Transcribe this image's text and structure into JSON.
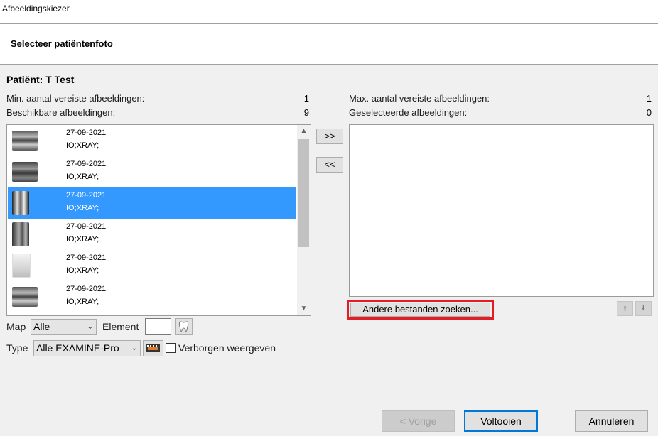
{
  "window": {
    "title": "Afbeeldingskiezer"
  },
  "header": {
    "title": "Selecteer patiëntenfoto"
  },
  "patient": {
    "label": "Patiënt: T Test"
  },
  "left": {
    "min_label": "Min. aantal vereiste afbeeldingen:",
    "min_value": "1",
    "available_label": "Beschikbare afbeeldingen:",
    "available_value": "9",
    "items": [
      {
        "date": "27-09-2021",
        "kind": "IO;XRAY;",
        "thumb": "bitewing-xray-thumbnail"
      },
      {
        "date": "27-09-2021",
        "kind": "IO;XRAY;",
        "thumb": "bitewing-xray-thumbnail"
      },
      {
        "date": "27-09-2021",
        "kind": "IO;XRAY;",
        "thumb": "periapical-xray-thumbnail",
        "selected": true
      },
      {
        "date": "27-09-2021",
        "kind": "IO;XRAY;",
        "thumb": "periapical-xray-thumbnail"
      },
      {
        "date": "27-09-2021",
        "kind": "IO;XRAY;",
        "thumb": "periapical-xray-thumbnail"
      },
      {
        "date": "27-09-2021",
        "kind": "IO;XRAY;",
        "thumb": "bitewing-xray-thumbnail"
      }
    ]
  },
  "right": {
    "max_label": "Max. aantal vereiste afbeeldingen:",
    "max_value": "1",
    "selected_label": "Geselecteerde afbeeldingen:",
    "selected_value": "0",
    "search_button": "Andere bestanden zoeken..."
  },
  "transfer": {
    "add_all": ">>",
    "remove_all": "<<"
  },
  "filters": {
    "map_label": "Map",
    "map_value": "Alle",
    "element_label": "Element",
    "type_label": "Type",
    "type_value": "Alle EXAMINE-Pro",
    "hidden_label": "Verborgen weergeven"
  },
  "footer": {
    "prev_button": "< Vorige",
    "finish_button": "Voltooien",
    "cancel_button": "Annuleren"
  },
  "colors": {
    "selection": "#3399ff",
    "highlight_border": "#e41c23",
    "default_button_border": "#0078d7"
  }
}
